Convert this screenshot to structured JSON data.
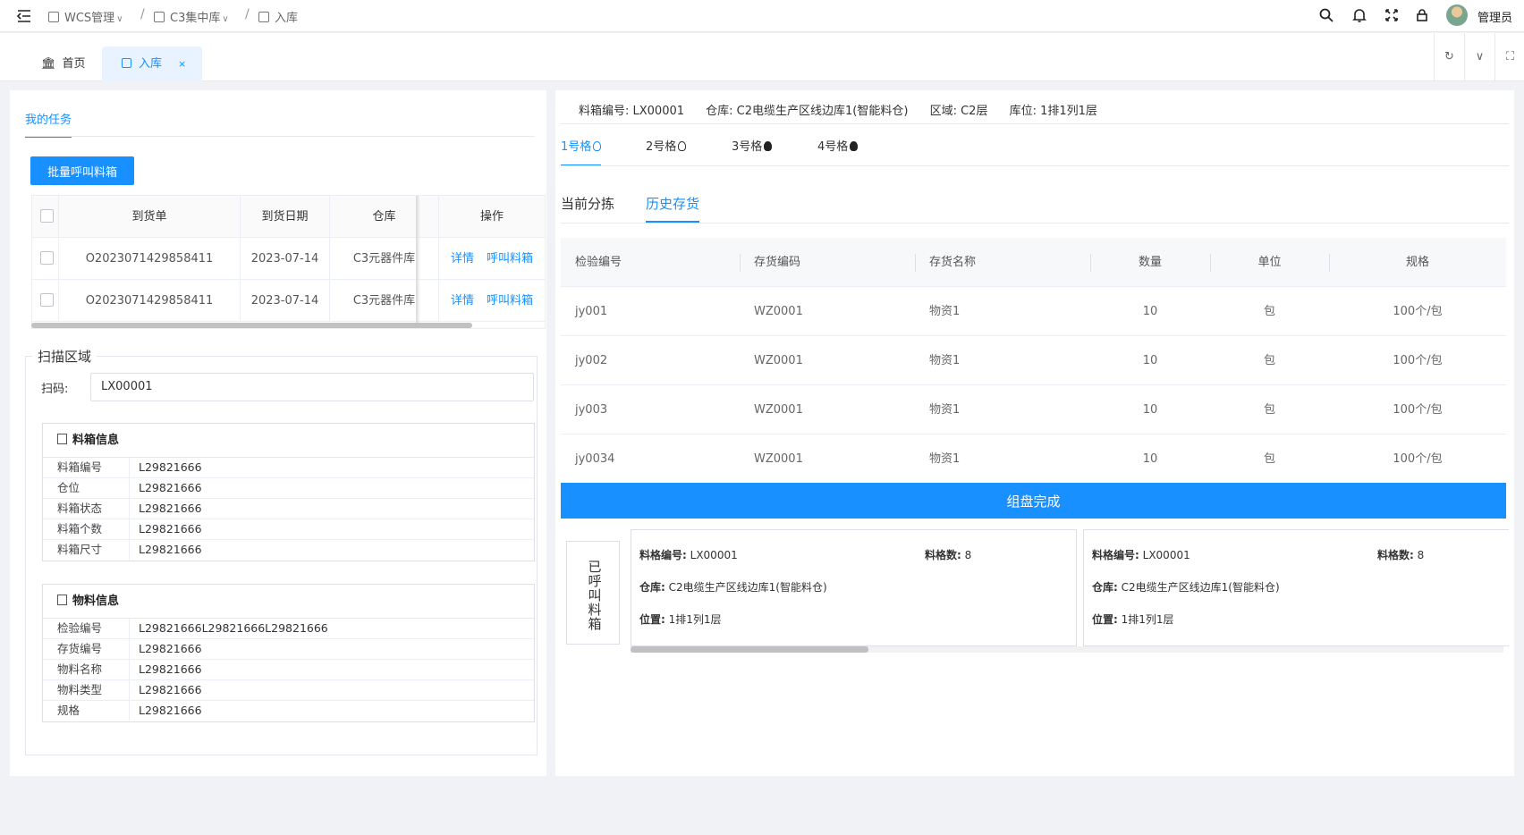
{
  "topbar": {
    "breadcrumb": [
      "WCS管理",
      "C3集中库",
      "入库"
    ],
    "separator": "/",
    "user": "管理员"
  },
  "tabs": {
    "home": "首页",
    "active": "入库",
    "close": "×"
  },
  "left": {
    "my_tasks_tab": "我的任务",
    "batch_button": "批量呼叫料箱",
    "table": {
      "headers": [
        "到货单",
        "到货日期",
        "仓库",
        "操作"
      ],
      "rows": [
        {
          "order": "O2023071429858411",
          "date": "2023-07-14",
          "warehouse": "C3元器件库",
          "action1": "详情",
          "action2": "呼叫料箱"
        },
        {
          "order": "O2023071429858411",
          "date": "2023-07-14",
          "warehouse": "C3元器件库",
          "action1": "详情",
          "action2": "呼叫料箱"
        }
      ]
    },
    "scan": {
      "legend": "扫描区域",
      "label": "扫码:",
      "value": "LX00001"
    },
    "box_info": {
      "title": "料箱信息",
      "rows": [
        {
          "k": "料箱编号",
          "v": "L29821666"
        },
        {
          "k": "仓位",
          "v": "L29821666"
        },
        {
          "k": "料箱状态",
          "v": "L29821666"
        },
        {
          "k": "料箱个数",
          "v": "L29821666"
        },
        {
          "k": "料箱尺寸",
          "v": "L29821666"
        }
      ]
    },
    "material_info": {
      "title": "物料信息",
      "rows": [
        {
          "k": "检验编号",
          "v": "L29821666L29821666L29821666"
        },
        {
          "k": "存货编号",
          "v": "L29821666"
        },
        {
          "k": "物料名称",
          "v": "L29821666"
        },
        {
          "k": "物料类型",
          "v": "L29821666"
        },
        {
          "k": "规格",
          "v": "L29821666"
        }
      ]
    }
  },
  "right": {
    "header": {
      "box_no": "料箱编号: LX00001",
      "warehouse": "仓库: C2电缆生产区线边库1(智能料仓)",
      "area": "区域: C2层",
      "location": "库位: 1排1列1层"
    },
    "grid_tabs": [
      "1号格",
      "2号格",
      "3号格",
      "4号格"
    ],
    "sub_tabs": [
      "当前分拣",
      "历史存货"
    ],
    "table": {
      "headers": [
        "检验编号",
        "存货编码",
        "存货名称",
        "数量",
        "单位",
        "规格"
      ],
      "rows": [
        [
          "jy001",
          "WZ0001",
          "物资1",
          "10",
          "包",
          "100个/包"
        ],
        [
          "jy002",
          "WZ0001",
          "物资1",
          "10",
          "包",
          "100个/包"
        ],
        [
          "jy003",
          "WZ0001",
          "物资1",
          "10",
          "包",
          "100个/包"
        ],
        [
          "jy0034",
          "WZ0001",
          "物资1",
          "10",
          "包",
          "100个/包"
        ]
      ]
    },
    "done_button": "组盘完成",
    "called_label": "已呼叫料箱",
    "cards": [
      {
        "box_label": "料格编号:",
        "box": "LX00001",
        "count_label": "料格数:",
        "count": "8",
        "wh_label": "仓库:",
        "wh": "C2电缆生产区线边库1(智能料仓)",
        "pos_label": "位置:",
        "pos": "1排1列1层"
      },
      {
        "box_label": "料格编号:",
        "box": "LX00001",
        "count_label": "料格数:",
        "count": "8",
        "wh_label": "仓库:",
        "wh": "C2电缆生产区线边库1(智能料仓)",
        "pos_label": "位置:",
        "pos": "1排1列1层"
      }
    ]
  }
}
